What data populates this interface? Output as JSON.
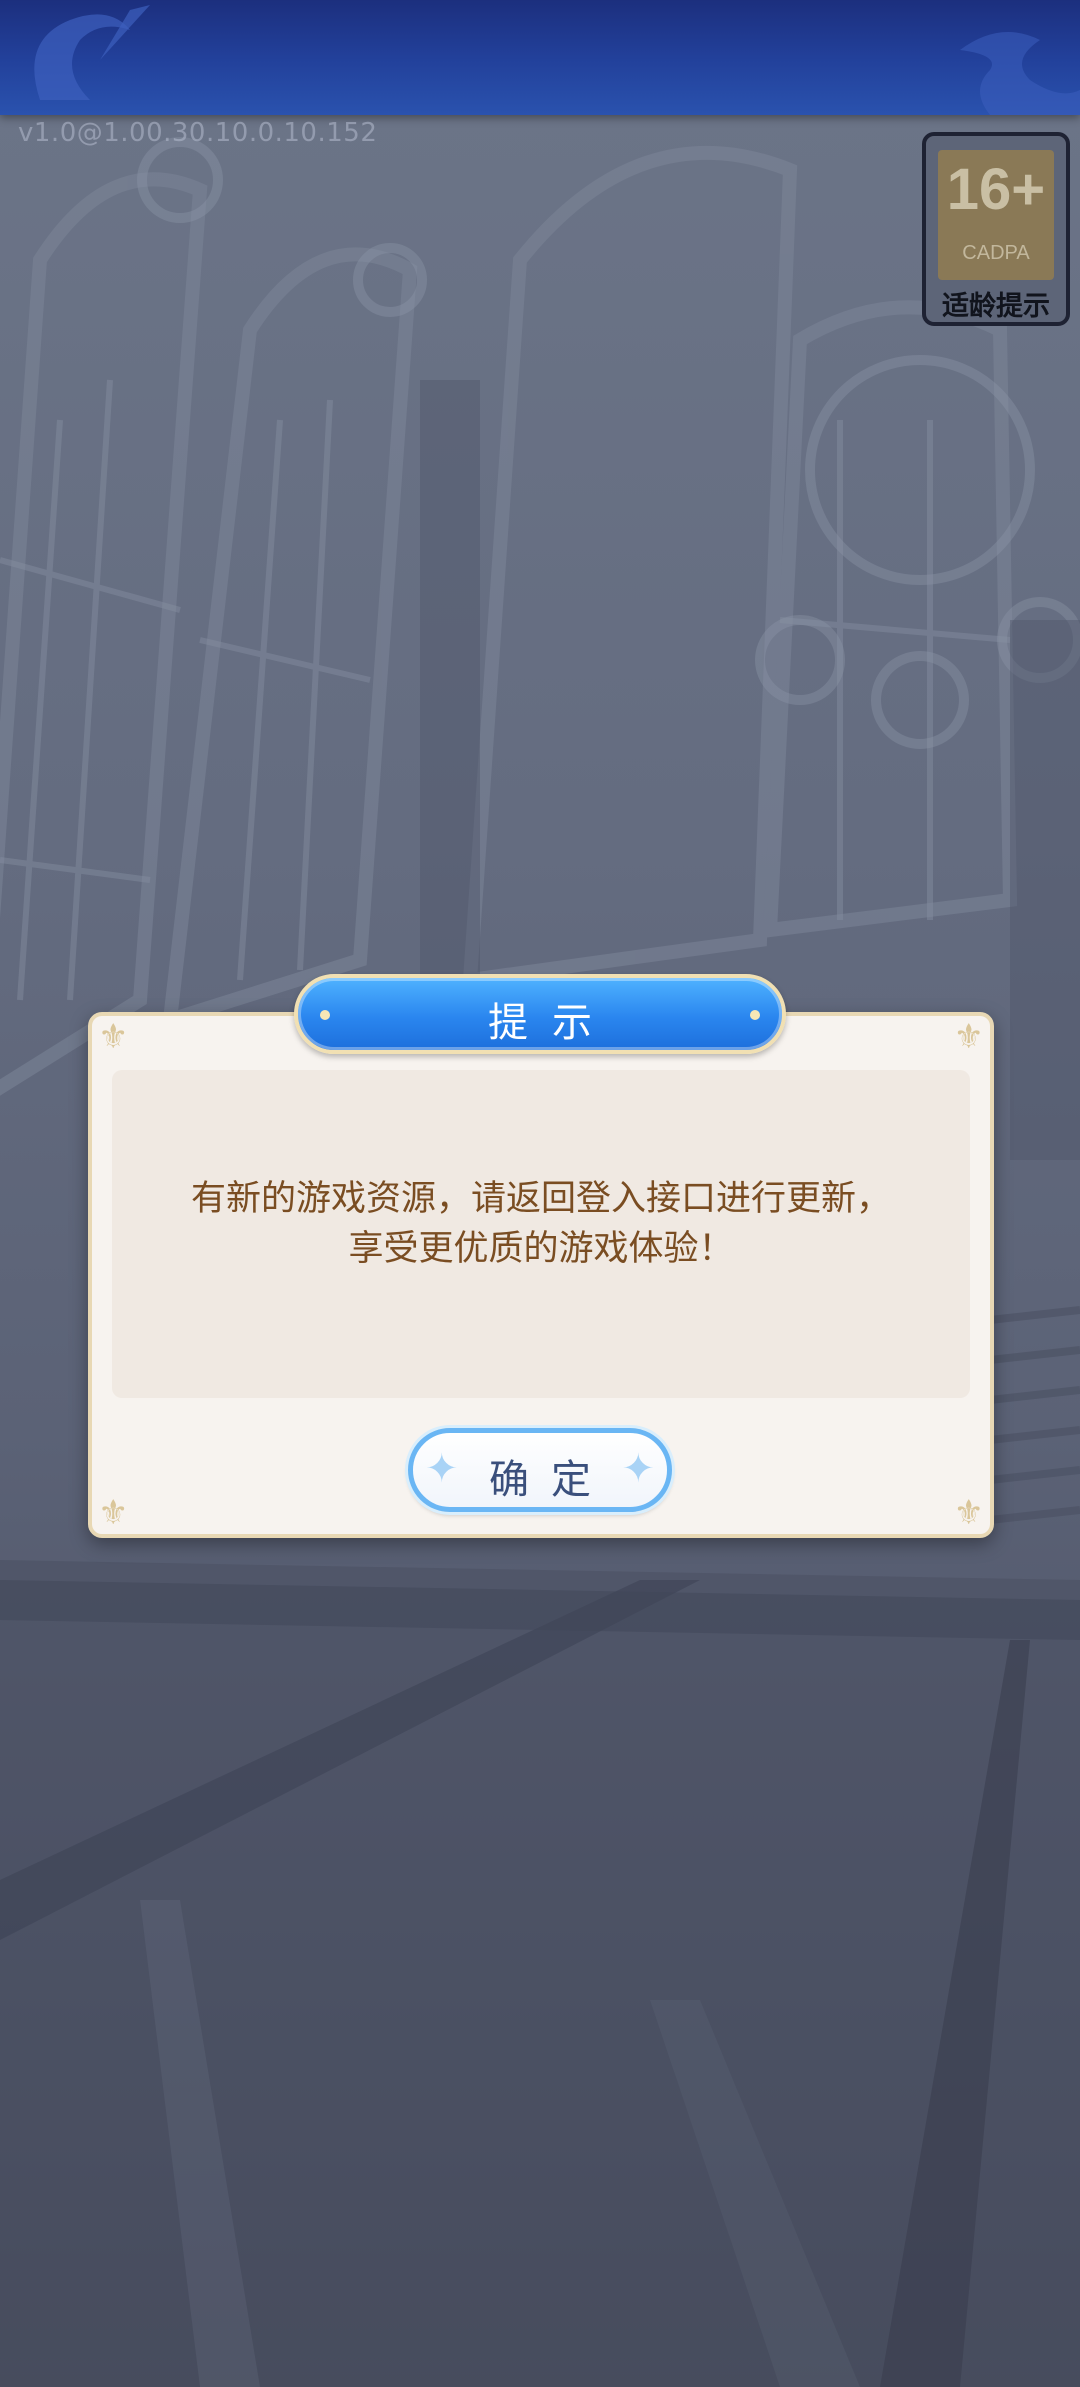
{
  "header": {
    "version": "v1.0@1.00.30.10.0.10.152"
  },
  "age_badge": {
    "rating": "16+",
    "org": "CADPA",
    "caption": "适龄提示"
  },
  "dialog": {
    "title": "提示",
    "message_line1": "有新的游戏资源，请返回登入接口进行更新，",
    "message_line2": "享受更优质的游戏体验！",
    "confirm_label": "确定"
  },
  "colors": {
    "topbar": "#22409a",
    "title_banner": "#2a86ef",
    "dialog_bg": "#f7f3ef",
    "dialog_border": "#e8d8b4",
    "message_text": "#7a4d22",
    "confirm_text": "#3a4f7c",
    "confirm_border": "#6ab6f4"
  },
  "icons": {
    "corner_ornament": "fleur-ornament-icon",
    "button_sparkle": "sparkle-icon"
  }
}
